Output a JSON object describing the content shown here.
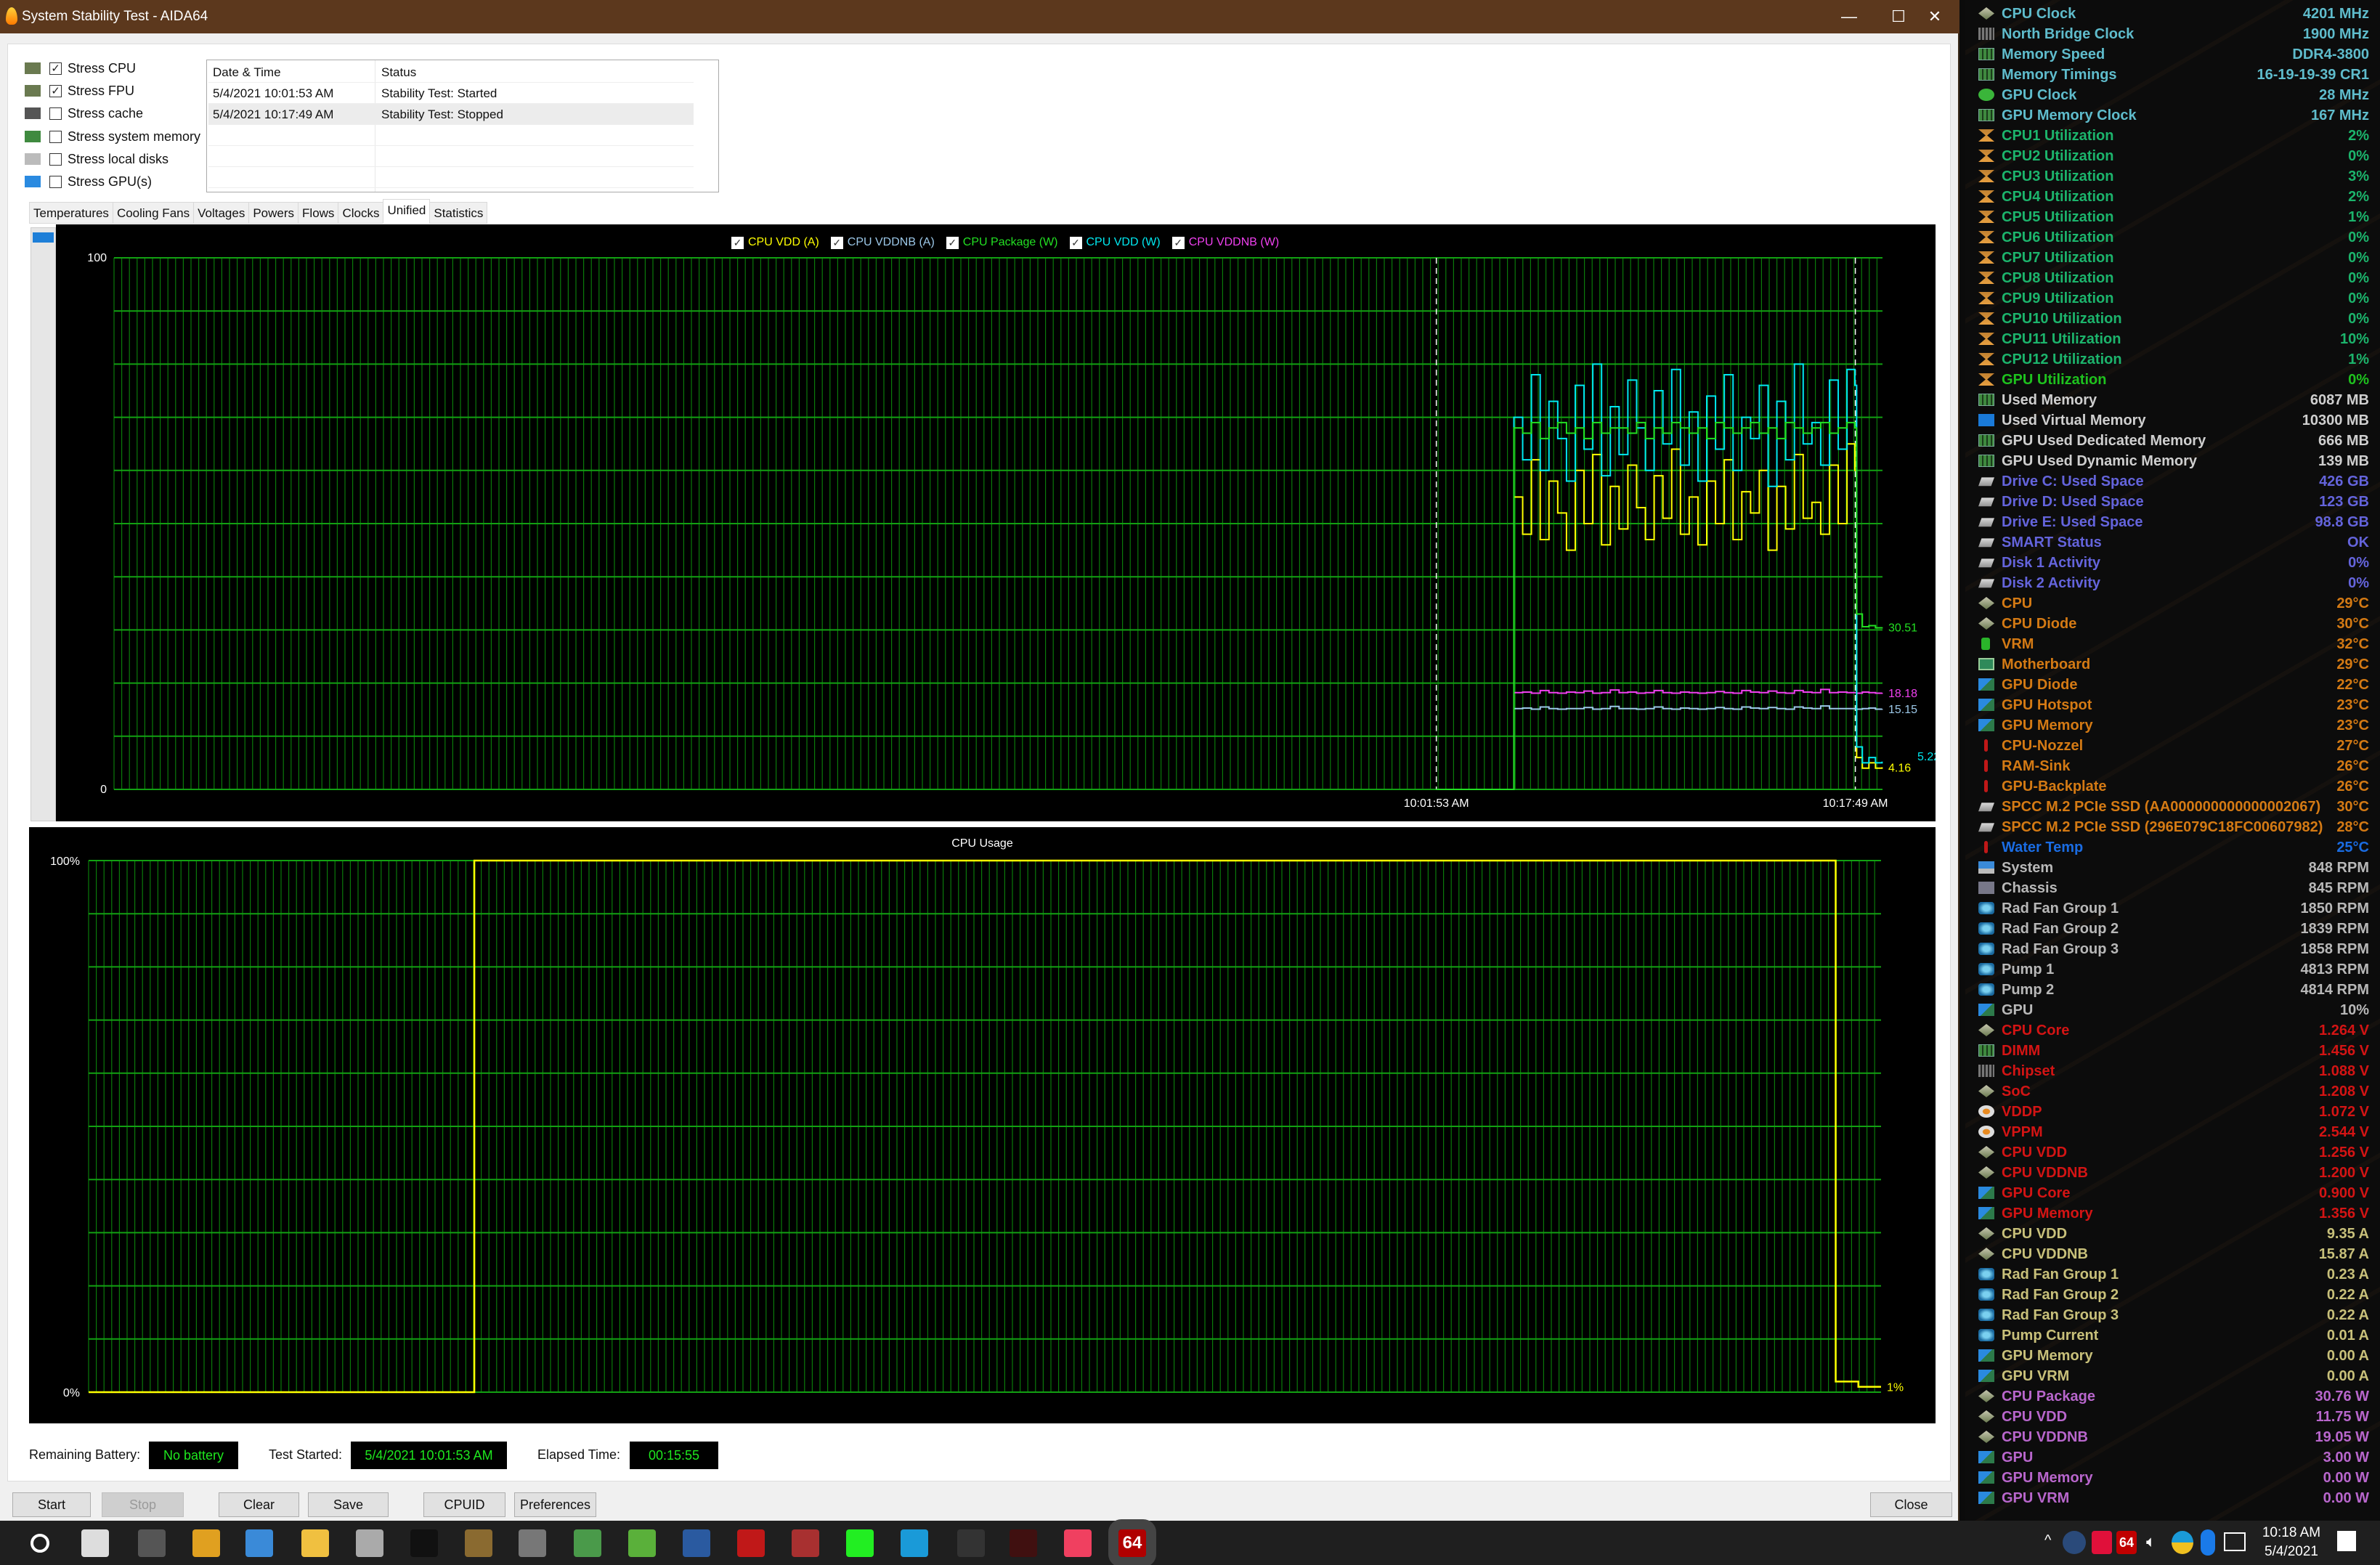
{
  "window": {
    "title": "System Stability Test - AIDA64",
    "minimize": "—",
    "maximize": "☐",
    "close": "✕"
  },
  "stress_options": [
    {
      "label": "Stress CPU",
      "checked": true,
      "icon": "cpu-chip-icon"
    },
    {
      "label": "Stress FPU",
      "checked": true,
      "icon": "fpu-chip-icon"
    },
    {
      "label": "Stress cache",
      "checked": false,
      "icon": "cache-chip-icon"
    },
    {
      "label": "Stress system memory",
      "checked": false,
      "icon": "ram-icon"
    },
    {
      "label": "Stress local disks",
      "checked": false,
      "icon": "drive-icon"
    },
    {
      "label": "Stress GPU(s)",
      "checked": false,
      "icon": "gpu-card-icon"
    }
  ],
  "log": {
    "headers": [
      "Date & Time",
      "Status"
    ],
    "rows": [
      [
        "5/4/2021 10:01:53 AM",
        "Stability Test: Started"
      ],
      [
        "5/4/2021 10:17:49 AM",
        "Stability Test: Stopped"
      ]
    ]
  },
  "tabs": {
    "items": [
      "Temperatures",
      "Cooling Fans",
      "Voltages",
      "Powers",
      "Flows",
      "Clocks",
      "Unified",
      "Statistics"
    ],
    "active": "Unified"
  },
  "chart_data": [
    {
      "type": "line",
      "title": "",
      "ylim": [
        0,
        100
      ],
      "yticks": [
        "100",
        "0"
      ],
      "xlim": [
        "09:11:36",
        "10:18:51"
      ],
      "xticks": [
        {
          "time": "10:01:53",
          "label": "10:01:53 AM"
        },
        {
          "time": "10:17:49",
          "label": "10:17:49 AM"
        }
      ],
      "grid": true,
      "legend_position": "top-center",
      "x": [
        "10:01:53",
        "10:04:49",
        "10:04:50",
        "10:05:10",
        "10:05:30",
        "10:05:50",
        "10:06:10",
        "10:06:30",
        "10:06:50",
        "10:07:10",
        "10:07:30",
        "10:07:50",
        "10:08:10",
        "10:08:30",
        "10:08:50",
        "10:09:10",
        "10:09:30",
        "10:09:50",
        "10:10:10",
        "10:10:30",
        "10:10:50",
        "10:11:10",
        "10:11:30",
        "10:11:50",
        "10:12:10",
        "10:12:30",
        "10:12:50",
        "10:13:10",
        "10:13:30",
        "10:13:50",
        "10:14:10",
        "10:14:30",
        "10:14:50",
        "10:15:10",
        "10:15:30",
        "10:15:50",
        "10:16:10",
        "10:16:30",
        "10:16:50",
        "10:17:10",
        "10:17:30",
        "10:17:48",
        "10:17:52",
        "10:18:05",
        "10:18:20",
        "10:18:35",
        "10:18:50"
      ],
      "series": [
        {
          "name": "CPU VDD (A)",
          "color": "#ffff00",
          "checked": true,
          "current": "4.16",
          "values": [
            0,
            0,
            55,
            48,
            62,
            47,
            58,
            52,
            45,
            60,
            50,
            63,
            46,
            57,
            49,
            61,
            53,
            47,
            59,
            51,
            64,
            48,
            55,
            46,
            58,
            50,
            62,
            47,
            56,
            52,
            60,
            45,
            57,
            49,
            63,
            51,
            54,
            48,
            61,
            50,
            65,
            60,
            6,
            4,
            5,
            4,
            4.16
          ]
        },
        {
          "name": "CPU VDDNB (A)",
          "color": "#9cc8e8",
          "checked": true,
          "current": "15.15",
          "values": [
            0,
            0,
            15.2,
            15.3,
            15.1,
            15.5,
            15.2,
            15.1,
            15.2,
            15.2,
            15.4,
            15.1,
            15.2,
            15.6,
            15.2,
            15.2,
            15.1,
            15.2,
            15.5,
            15.2,
            15.1,
            15.3,
            15.2,
            15.1,
            15.2,
            15.4,
            15.2,
            15.1,
            15.5,
            15.3,
            15.2,
            15.4,
            15.2,
            15.1,
            15.5,
            15.3,
            15.2,
            15.7,
            15.2,
            15.2,
            15.2,
            15.2,
            15.1,
            15.2,
            15.3,
            15.1,
            15.15
          ]
        },
        {
          "name": "CPU Package (W)",
          "color": "#22e022",
          "checked": true,
          "current": "30.51",
          "values": [
            0,
            0,
            68,
            67,
            69,
            66,
            68,
            69,
            67,
            68,
            66,
            69,
            67,
            68,
            68,
            67,
            69,
            66,
            68,
            67,
            69,
            68,
            67,
            68,
            66,
            69,
            68,
            67,
            68,
            69,
            67,
            68,
            66,
            69,
            68,
            67,
            68,
            69,
            67,
            68,
            69,
            68,
            33,
            30.6,
            30.8,
            30.4,
            30.51
          ]
        },
        {
          "name": "CPU VDD (W)",
          "color": "#00e8f0",
          "checked": true,
          "current": "5.22",
          "values": [
            0,
            0,
            70,
            62,
            78,
            60,
            73,
            66,
            58,
            76,
            64,
            80,
            59,
            72,
            63,
            77,
            68,
            60,
            75,
            65,
            79,
            61,
            71,
            58,
            74,
            64,
            78,
            60,
            70,
            66,
            76,
            57,
            73,
            62,
            80,
            65,
            69,
            61,
            77,
            64,
            79,
            76,
            8,
            5,
            6,
            5,
            5.22
          ]
        },
        {
          "name": "CPU VDDNB (W)",
          "color": "#f040f0",
          "checked": true,
          "current": "18.18",
          "values": [
            0,
            0,
            18.2,
            18.3,
            18.1,
            18.6,
            18.2,
            18.1,
            18.3,
            18.2,
            18.5,
            18.1,
            18.2,
            18.7,
            18.2,
            18.3,
            18.1,
            18.2,
            18.6,
            18.2,
            18.1,
            18.3,
            18.2,
            18.1,
            18.2,
            18.4,
            18.2,
            18.1,
            18.6,
            18.3,
            18.2,
            18.5,
            18.2,
            18.1,
            18.6,
            18.3,
            18.2,
            18.8,
            18.2,
            18.3,
            18.2,
            18.2,
            18.1,
            18.3,
            18.2,
            18.1,
            18.18
          ]
        }
      ]
    },
    {
      "type": "line",
      "title": "CPU Usage",
      "ylim": [
        0,
        100
      ],
      "yticks": [
        "100%",
        "0%"
      ],
      "grid": true,
      "series": [
        {
          "color": "#ffff00",
          "current": "1%",
          "values": [
            0,
            0,
            0,
            0,
            0,
            0,
            0,
            0,
            0,
            0,
            0,
            0,
            0,
            0,
            0,
            0,
            0,
            100,
            100,
            100,
            100,
            100,
            100,
            100,
            100,
            100,
            100,
            100,
            100,
            100,
            100,
            100,
            100,
            100,
            100,
            100,
            100,
            100,
            100,
            100,
            100,
            100,
            100,
            100,
            100,
            100,
            100,
            100,
            100,
            100,
            100,
            100,
            100,
            100,
            100,
            100,
            100,
            100,
            100,
            100,
            100,
            100,
            100,
            100,
            100,
            100,
            100,
            100,
            100,
            100,
            100,
            100,
            100,
            100,
            100,
            100,
            100,
            2,
            1,
            1
          ]
        }
      ]
    }
  ],
  "footer": {
    "battery_label": "Remaining Battery:",
    "battery_value": "No battery",
    "started_label": "Test Started:",
    "started_value": "5/4/2021 10:01:53 AM",
    "elapsed_label": "Elapsed Time:",
    "elapsed_value": "00:15:55"
  },
  "buttons": {
    "start": "Start",
    "stop": "Stop",
    "clear": "Clear",
    "save": "Save",
    "cpuid": "CPUID",
    "preferences": "Preferences",
    "close": "Close"
  },
  "sensor_colors": {
    "clock": "#5fbccc",
    "util": "#1cb46c",
    "gpuutil": "#1ec21e",
    "mem": "#cfcfcf",
    "drive": "#6464dc",
    "temp": "#d47a14",
    "water": "#1a6ce2",
    "fan": "#b8b8b8",
    "volt": "#d41414",
    "amp": "#c8c07a",
    "power": "#b866cc"
  },
  "sensors": [
    {
      "label": "CPU Clock",
      "value": "4201 MHz",
      "group": "clock",
      "icon": "cpu"
    },
    {
      "label": "North Bridge Clock",
      "value": "1900 MHz",
      "group": "clock",
      "icon": "chip"
    },
    {
      "label": "Memory Speed",
      "value": "DDR4-3800",
      "group": "clock",
      "icon": "ram"
    },
    {
      "label": "Memory Timings",
      "value": "16-19-19-39 CR1",
      "group": "clock",
      "icon": "ram"
    },
    {
      "label": "GPU Clock",
      "value": "28 MHz",
      "group": "clock",
      "icon": "xbox"
    },
    {
      "label": "GPU Memory Clock",
      "value": "167 MHz",
      "group": "clock",
      "icon": "ram"
    },
    {
      "label": "CPU1 Utilization",
      "value": "2%",
      "group": "util",
      "icon": "hour"
    },
    {
      "label": "CPU2 Utilization",
      "value": "0%",
      "group": "util",
      "icon": "hour"
    },
    {
      "label": "CPU3 Utilization",
      "value": "3%",
      "group": "util",
      "icon": "hour"
    },
    {
      "label": "CPU4 Utilization",
      "value": "2%",
      "group": "util",
      "icon": "hour"
    },
    {
      "label": "CPU5 Utilization",
      "value": "1%",
      "group": "util",
      "icon": "hour"
    },
    {
      "label": "CPU6 Utilization",
      "value": "0%",
      "group": "util",
      "icon": "hour"
    },
    {
      "label": "CPU7 Utilization",
      "value": "0%",
      "group": "util",
      "icon": "hour"
    },
    {
      "label": "CPU8 Utilization",
      "value": "0%",
      "group": "util",
      "icon": "hour"
    },
    {
      "label": "CPU9 Utilization",
      "value": "0%",
      "group": "util",
      "icon": "hour"
    },
    {
      "label": "CPU10 Utilization",
      "value": "0%",
      "group": "util",
      "icon": "hour"
    },
    {
      "label": "CPU11 Utilization",
      "value": "10%",
      "group": "util",
      "icon": "hour"
    },
    {
      "label": "CPU12 Utilization",
      "value": "1%",
      "group": "util",
      "icon": "hour"
    },
    {
      "label": "GPU Utilization",
      "value": "0%",
      "group": "gpuutil",
      "icon": "hour"
    },
    {
      "label": "Used Memory",
      "value": "6087 MB",
      "group": "mem",
      "icon": "ram"
    },
    {
      "label": "Used Virtual Memory",
      "value": "10300 MB",
      "group": "mem",
      "icon": "win"
    },
    {
      "label": "GPU Used Dedicated Memory",
      "value": "666 MB",
      "group": "mem",
      "icon": "ram"
    },
    {
      "label": "GPU Used Dynamic Memory",
      "value": "139 MB",
      "group": "mem",
      "icon": "ram"
    },
    {
      "label": "Drive C: Used Space",
      "value": "426 GB",
      "group": "drive",
      "icon": "drive"
    },
    {
      "label": "Drive D: Used Space",
      "value": "123 GB",
      "group": "drive",
      "icon": "drive"
    },
    {
      "label": "Drive E: Used Space",
      "value": "98.8 GB",
      "group": "drive",
      "icon": "drive"
    },
    {
      "label": "SMART Status",
      "value": "OK",
      "group": "drive",
      "icon": "drive"
    },
    {
      "label": "Disk 1 Activity",
      "value": "0%",
      "group": "drive",
      "icon": "drive"
    },
    {
      "label": "Disk 2 Activity",
      "value": "0%",
      "group": "drive",
      "icon": "drive"
    },
    {
      "label": "CPU",
      "value": "29°C",
      "group": "temp",
      "icon": "cpu"
    },
    {
      "label": "CPU Diode",
      "value": "30°C",
      "group": "temp",
      "icon": "cpu"
    },
    {
      "label": "VRM",
      "value": "32°C",
      "group": "temp",
      "icon": "batt"
    },
    {
      "label": "Motherboard",
      "value": "29°C",
      "group": "temp",
      "icon": "mobo"
    },
    {
      "label": "GPU Diode",
      "value": "22°C",
      "group": "temp",
      "icon": "gpu"
    },
    {
      "label": "GPU Hotspot",
      "value": "23°C",
      "group": "temp",
      "icon": "gpu"
    },
    {
      "label": "GPU Memory",
      "value": "23°C",
      "group": "temp",
      "icon": "gpu"
    },
    {
      "label": "CPU-Nozzel",
      "value": "27°C",
      "group": "temp",
      "icon": "therm"
    },
    {
      "label": "RAM-Sink",
      "value": "26°C",
      "group": "temp",
      "icon": "therm"
    },
    {
      "label": "GPU-Backplate",
      "value": "26°C",
      "group": "temp",
      "icon": "therm"
    },
    {
      "label": "SPCC M.2 PCIe SSD (AA000000000000002067)",
      "value": "30°C",
      "group": "temp",
      "icon": "drive"
    },
    {
      "label": "SPCC M.2 PCIe SSD (296E079C18FC00607982)",
      "value": "28°C",
      "group": "temp",
      "icon": "drive"
    },
    {
      "label": "Water Temp",
      "value": "25°C",
      "group": "water",
      "icon": "therm"
    },
    {
      "label": "System",
      "value": "848 RPM",
      "group": "fan",
      "icon": "pc"
    },
    {
      "label": "Chassis",
      "value": "845 RPM",
      "group": "fan",
      "icon": "case"
    },
    {
      "label": "Rad Fan Group 1",
      "value": "1850 RPM",
      "group": "fan",
      "icon": "fan"
    },
    {
      "label": "Rad Fan Group 2",
      "value": "1839 RPM",
      "group": "fan",
      "icon": "fan"
    },
    {
      "label": "Rad Fan Group 3",
      "value": "1858 RPM",
      "group": "fan",
      "icon": "fan"
    },
    {
      "label": "Pump 1",
      "value": "4813 RPM",
      "group": "fan",
      "icon": "fan"
    },
    {
      "label": "Pump 2",
      "value": "4814 RPM",
      "group": "fan",
      "icon": "fan"
    },
    {
      "label": "GPU",
      "value": "10%",
      "group": "fan",
      "icon": "gpu"
    },
    {
      "label": "CPU Core",
      "value": "1.264 V",
      "group": "volt",
      "icon": "cpu"
    },
    {
      "label": "DIMM",
      "value": "1.456 V",
      "group": "volt",
      "icon": "ram"
    },
    {
      "label": "Chipset",
      "value": "1.088 V",
      "group": "volt",
      "icon": "chip"
    },
    {
      "label": "SoC",
      "value": "1.208 V",
      "group": "volt",
      "icon": "cpu"
    },
    {
      "label": "VDDP",
      "value": "1.072 V",
      "group": "volt",
      "icon": "bolt"
    },
    {
      "label": "VPPM",
      "value": "2.544 V",
      "group": "volt",
      "icon": "bolt"
    },
    {
      "label": "CPU VDD",
      "value": "1.256 V",
      "group": "volt",
      "icon": "cpu"
    },
    {
      "label": "CPU VDDNB",
      "value": "1.200 V",
      "group": "volt",
      "icon": "cpu"
    },
    {
      "label": "GPU Core",
      "value": "0.900 V",
      "group": "volt",
      "icon": "gpu"
    },
    {
      "label": "GPU Memory",
      "value": "1.356 V",
      "group": "volt",
      "icon": "gpu"
    },
    {
      "label": "CPU VDD",
      "value": "9.35 A",
      "group": "amp",
      "icon": "cpu"
    },
    {
      "label": "CPU VDDNB",
      "value": "15.87 A",
      "group": "amp",
      "icon": "cpu"
    },
    {
      "label": "Rad Fan Group 1",
      "value": "0.23 A",
      "group": "amp",
      "icon": "fan"
    },
    {
      "label": "Rad Fan Group 2",
      "value": "0.22 A",
      "group": "amp",
      "icon": "fan"
    },
    {
      "label": "Rad Fan Group 3",
      "value": "0.22 A",
      "group": "amp",
      "icon": "fan"
    },
    {
      "label": "Pump Current",
      "value": "0.01 A",
      "group": "amp",
      "icon": "fan"
    },
    {
      "label": "GPU Memory",
      "value": "0.00 A",
      "group": "amp",
      "icon": "gpu"
    },
    {
      "label": "GPU VRM",
      "value": "0.00 A",
      "group": "amp",
      "icon": "gpu"
    },
    {
      "label": "CPU Package",
      "value": "30.76 W",
      "group": "power",
      "icon": "cpu"
    },
    {
      "label": "CPU VDD",
      "value": "11.75 W",
      "group": "power",
      "icon": "cpu"
    },
    {
      "label": "CPU VDDNB",
      "value": "19.05 W",
      "group": "power",
      "icon": "cpu"
    },
    {
      "label": "GPU",
      "value": "3.00 W",
      "group": "power",
      "icon": "gpu"
    },
    {
      "label": "GPU Memory",
      "value": "0.00 W",
      "group": "power",
      "icon": "gpu"
    },
    {
      "label": "GPU VRM",
      "value": "0.00 W",
      "group": "power",
      "icon": "gpu"
    }
  ],
  "taskbar": {
    "apps": [
      {
        "name": "start-button",
        "color": "#ffffff"
      },
      {
        "name": "task-view-button",
        "color": "#dddddd"
      },
      {
        "name": "uefi-app",
        "color": "#555555"
      },
      {
        "name": "chrome-app",
        "color": "#e0a020"
      },
      {
        "name": "media-player-app",
        "color": "#3a8ad8"
      },
      {
        "name": "file-explorer-app",
        "color": "#f0c040"
      },
      {
        "name": "yin-yang-app",
        "color": "#aaaaaa"
      },
      {
        "name": "ryzen-master-app",
        "color": "#111111"
      },
      {
        "name": "arrow-app",
        "color": "#8a6a30"
      },
      {
        "name": "cpu-z-app",
        "color": "#777777"
      },
      {
        "name": "gpu-card-app",
        "color": "#4a9a4a"
      },
      {
        "name": "xbox-like-app",
        "color": "#5ab03a"
      },
      {
        "name": "cinebench-app",
        "color": "#2a5aa0"
      },
      {
        "name": "flash-app",
        "color": "#c01818"
      },
      {
        "name": "red-cross-app",
        "color": "#a83030"
      },
      {
        "name": "prime95-app",
        "color": "#22ee22"
      },
      {
        "name": "sync-app",
        "color": "#1a9ad8"
      },
      {
        "name": "asrock-polychrome-app",
        "color": "#333333"
      },
      {
        "name": "rosewill-app",
        "color": "#401010"
      },
      {
        "name": "colorful-balls-app",
        "color": "#f04060"
      },
      {
        "name": "aida64-app",
        "color": "#b00000",
        "label": "64"
      }
    ],
    "tray": {
      "chevron": "^",
      "aida_badge": "64"
    },
    "time": "10:18 AM",
    "date": "5/4/2021"
  }
}
